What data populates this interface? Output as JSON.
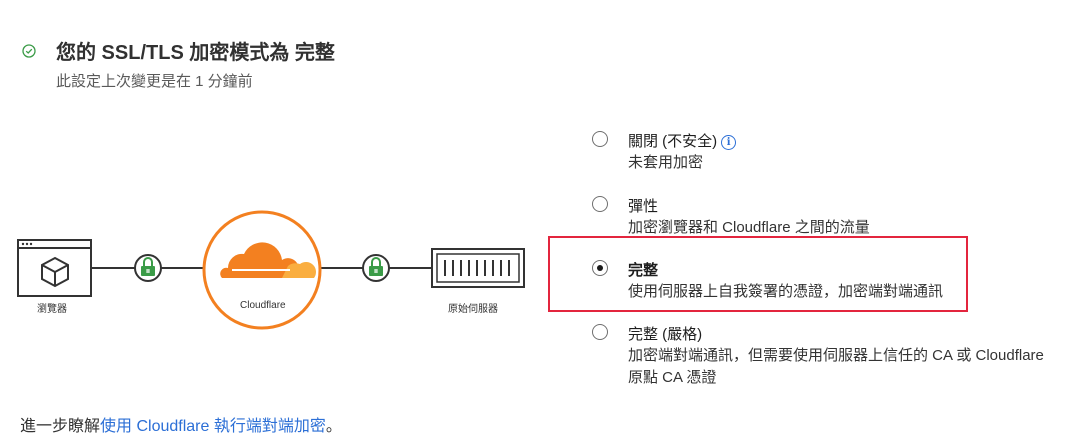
{
  "header": {
    "title": "您的 SSL/TLS 加密模式為 完整",
    "subtitle": "此設定上次變更是在 1 分鐘前"
  },
  "diagram": {
    "browser_label": "瀏覽器",
    "cloudflare_label": "Cloudflare",
    "origin_label": "原始伺服器"
  },
  "options": [
    {
      "title": "關閉 (不安全)",
      "desc": "未套用加密",
      "selected": false
    },
    {
      "title": "彈性",
      "desc": "加密瀏覽器和 Cloudflare 之間的流量",
      "selected": false
    },
    {
      "title": "完整",
      "desc": "使用伺服器上自我簽署的憑證，加密端對端通訊",
      "selected": true
    },
    {
      "title": "完整 (嚴格)",
      "desc_line1": "加密端對端通訊，但需要使用伺服器上信任的 CA 或 Cloudflare",
      "desc_line2": "原點 CA 憑證",
      "selected": false
    }
  ],
  "footer": {
    "prefix": "進一步瞭解",
    "link": "使用 Cloudflare 執行端對端加密",
    "suffix": "。"
  },
  "colors": {
    "accent_orange": "#f38020",
    "cloud_light": "#faae40",
    "lock_green": "#3a9b47",
    "highlight_red": "#e3253e",
    "link_blue": "#2c6fd6"
  }
}
